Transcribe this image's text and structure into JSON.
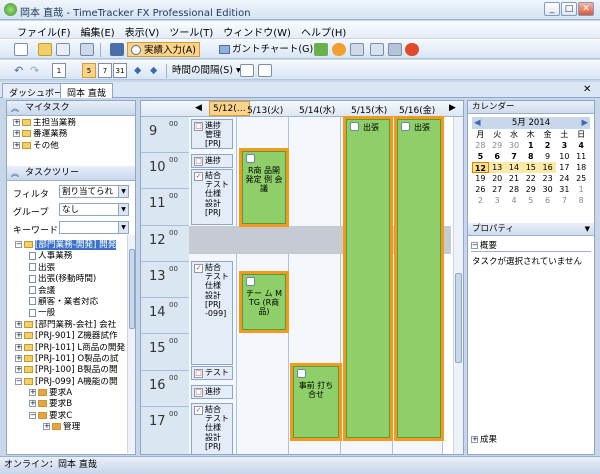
{
  "window": {
    "title": "岡本 直哉 - TimeTracker FX Professional Edition"
  },
  "menu": [
    "ファイル(F)",
    "編集(E)",
    "表示(V)",
    "ツール(T)",
    "ウィンドウ(W)",
    "ヘルプ(H)"
  ],
  "toolbar": {
    "actual_input": "実績入力(A)",
    "gantt": "ガントチャート(G)",
    "interval": "時間の間隔(S)"
  },
  "view_buttons": [
    "1",
    "5",
    "7",
    "31"
  ],
  "tabs": {
    "dashboard": "ダッシュボード",
    "user": "岡本 直哉"
  },
  "left": {
    "mytask_header": "マイタスク",
    "mytask_items": [
      "主担当業務",
      "番運業務",
      "その他"
    ],
    "tasktree_header": "タスクツリー",
    "filter_label": "フィルタ",
    "filter_value": "割り当てられ",
    "group_label": "グループ",
    "group_value": "なし",
    "keyword_label": "キーワード",
    "keyword_value": "",
    "tree_items": [
      "[部門業務-開発] 開発",
      "人事業務",
      "出張",
      "出張(移動時間)",
      "会議",
      "顧客・業者対応",
      "一般",
      "[部門業務-会社] 会社",
      "[PRJ-901] Z機器試作",
      "[PRJ-101] L商品の開発",
      "[PRJ-101] O製品の試",
      "[PRJ-100] B製品の開",
      "[PRJ-099] A機能の開",
      "要求A",
      "要求B",
      "要求C",
      "管理"
    ]
  },
  "calendar": {
    "days": [
      "5/12(…",
      "5/13(火)",
      "5/14(水)",
      "5/15(木)",
      "5/16(金)"
    ],
    "hours": [
      "9",
      "10",
      "11",
      "12",
      "13",
      "14",
      "15",
      "16",
      "17"
    ],
    "minute_label": "00",
    "banners": [
      "出張",
      "出張"
    ],
    "appointments": [
      "進捗\n管理\n[PRJ",
      "進捗",
      "結合\nテスト\n仕様\n設計\n[PRJ",
      "結合\nテスト\n仕様\n設計\n[PRJ\n-099]",
      "テスト",
      "進捗",
      "結合\nテスト\n仕様\n設計\n[PRJ"
    ],
    "green_events": [
      "R商\n品開\n発定\n例\n会議",
      "チー\nム\nMTG\n(R商\n品)",
      "事前\n打ち\n合せ"
    ]
  },
  "right": {
    "calendar_header": "カレンダー",
    "month": "5月 2014",
    "weekdays": [
      "月",
      "火",
      "水",
      "木",
      "金",
      "土",
      "日"
    ],
    "days": [
      "28",
      "29",
      "30",
      "1",
      "2",
      "3",
      "4",
      "5",
      "6",
      "7",
      "8",
      "9",
      "10",
      "11",
      "12",
      "13",
      "14",
      "15",
      "16",
      "17",
      "18",
      "19",
      "20",
      "21",
      "22",
      "23",
      "24",
      "25",
      "26",
      "27",
      "28",
      "29",
      "30",
      "31",
      "1",
      "2",
      "3",
      "4",
      "5",
      "6",
      "7",
      "8"
    ],
    "properties_header": "プロパティ",
    "overview_label": "概要",
    "no_task": "タスクが選択されていません",
    "results_label": "成果"
  },
  "status": {
    "text": "オンライン：岡本 直哉"
  }
}
